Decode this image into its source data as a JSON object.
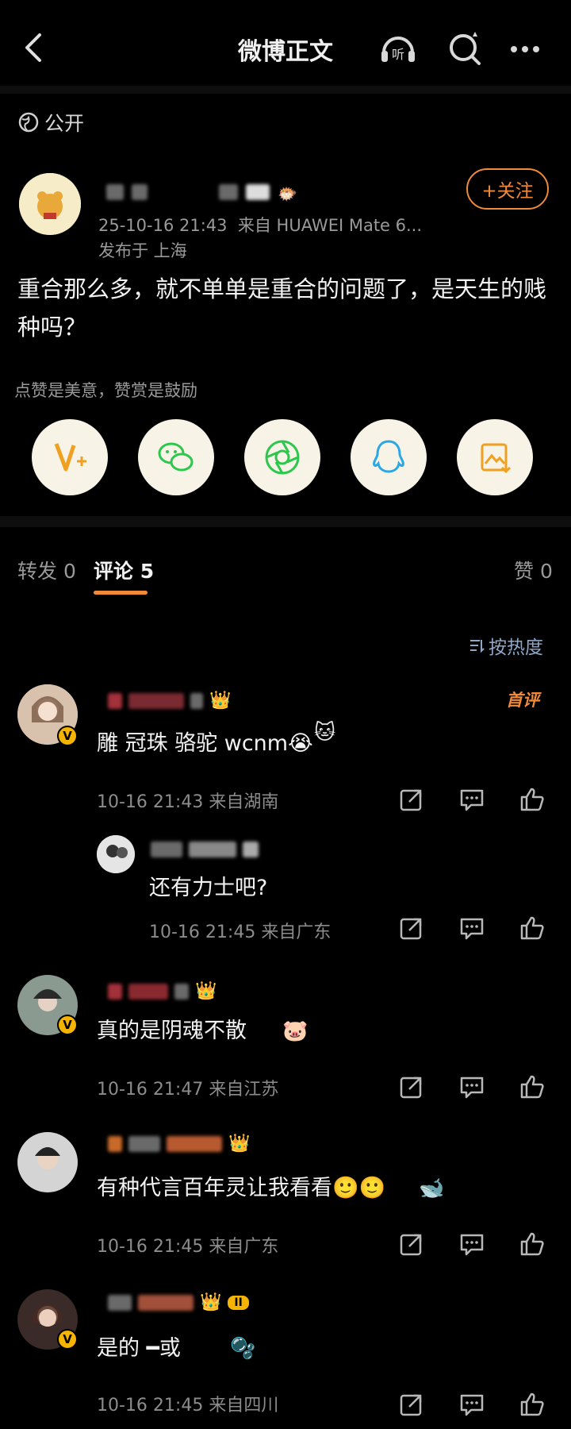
{
  "header": {
    "title": "微博正文"
  },
  "visibility": "公开",
  "post": {
    "time": "25-10-16 21:43",
    "source": "来自 HUAWEI Mate 6...",
    "location": "发布于 上海",
    "follow_label": "+关注",
    "text": "重合那么多，就不单单是重合的问题了，是天生的贱种吗？",
    "reward_text": "点赞是美意，赞赏是鼓励"
  },
  "tabs": {
    "repost": "转发 0",
    "comments": "评论 5",
    "likes": "赞 0"
  },
  "sort_label": "按热度",
  "comments": [
    {
      "text": "雕 冠珠 骆驼 wcnm😭",
      "time": "10-16 21:43",
      "location": "来自湖南",
      "badge": "首评"
    },
    {
      "text": "还有力士吧?",
      "time": "10-16 21:45",
      "location": "来自广东"
    },
    {
      "text": "真的是阴魂不散",
      "time": "10-16 21:47",
      "location": "来自江苏"
    },
    {
      "text": "有种代言百年灵让我看看🙂🙂",
      "time": "10-16 21:45",
      "location": "来自广东"
    },
    {
      "text": "是的 ━或",
      "time": "10-16 21:45",
      "location": "来自四川",
      "level": "II"
    }
  ],
  "colors": {
    "accent": "#f08a3a",
    "background": "#000000",
    "link": "#8fa6c8",
    "vip": "#f5b400"
  }
}
